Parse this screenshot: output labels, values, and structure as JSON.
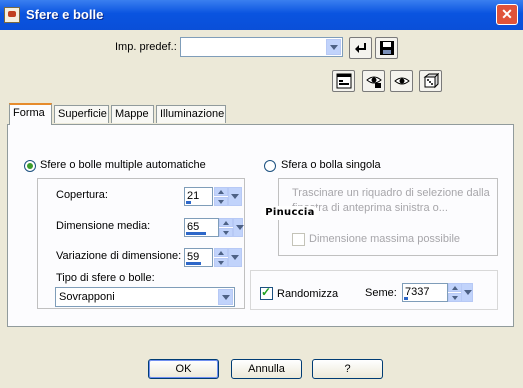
{
  "window": {
    "title": "Sfere e bolle",
    "close_label": "✕"
  },
  "presets": {
    "label": "Imp. predef.:",
    "value": ""
  },
  "tabs": [
    {
      "label": "Forma",
      "active": true
    },
    {
      "label": "Superficie",
      "active": false
    },
    {
      "label": "Mappe",
      "active": false
    },
    {
      "label": "Illuminazione",
      "active": false
    }
  ],
  "auto": {
    "radio_label": "Sfere o bolle multiple automatiche",
    "selected": true,
    "coverage": {
      "label": "Copertura:",
      "value": "21",
      "level": 0.21
    },
    "size": {
      "label": "Dimensione media:",
      "value": "65",
      "level": 0.65
    },
    "variation": {
      "label": "Variazione di dimensione:",
      "value": "59",
      "level": 0.59
    },
    "type": {
      "label": "Tipo di sfere o bolle:",
      "value": "Sovrapponi"
    }
  },
  "single": {
    "radio_label": "Sfera o bolla singola",
    "selected": false,
    "hint_line1": "Trascinare un riquadro di selezione dalla",
    "hint_line2": "finestra di anteprima sinistra o...",
    "max_size_label": "Dimensione massima possibile",
    "max_size_checked": false
  },
  "randomize": {
    "label": "Randomizza",
    "checked": true
  },
  "seed": {
    "label": "Seme:",
    "value": "7337"
  },
  "watermark": "Pinuccia",
  "buttons": {
    "ok": "OK",
    "cancel": "Annulla",
    "help": "?"
  },
  "colors": {
    "titlebar": "#0a54e0",
    "dialog_bg": "#ece9d8",
    "active_tab": "#e68b2c",
    "accent": "#2d67c9"
  }
}
